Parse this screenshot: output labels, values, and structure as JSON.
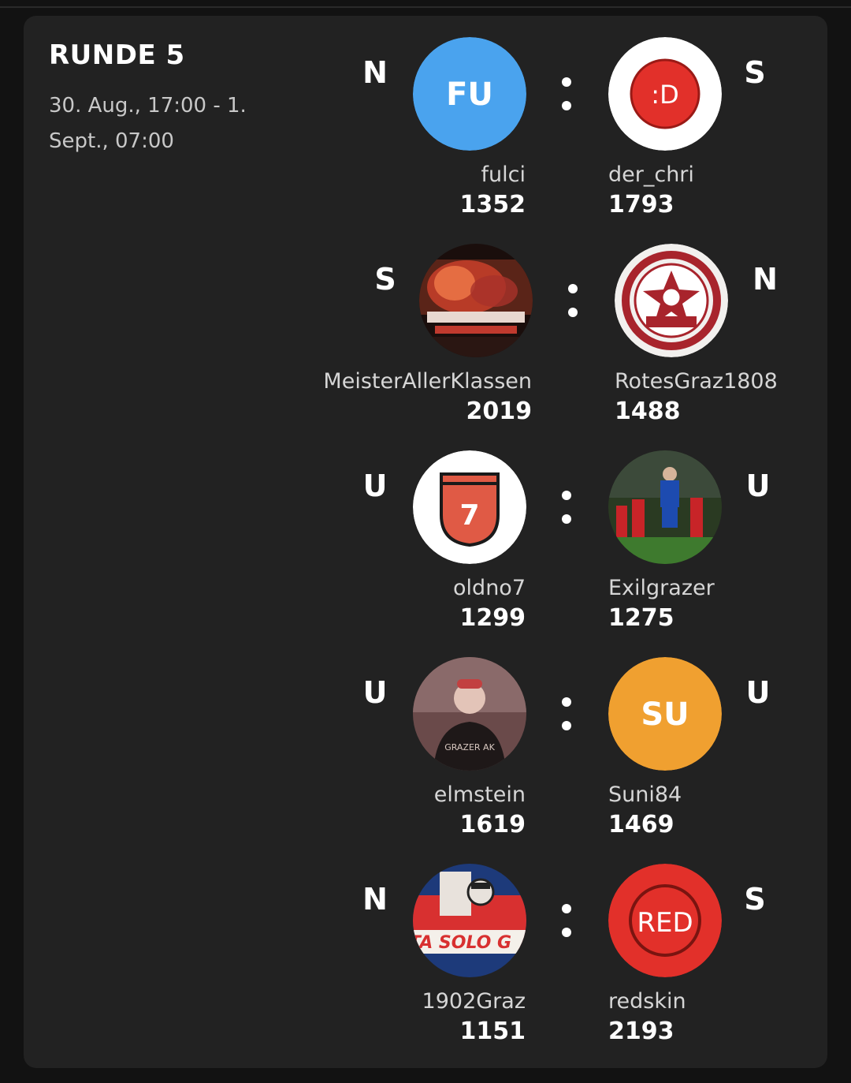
{
  "round": {
    "title": "RUNDE 5",
    "date": "30. Aug., 17:00 - 1. Sept., 07:00"
  },
  "colors": {
    "card_bg": "#222222",
    "page_bg": "#121212",
    "fu_avatar": "#4aa3ee",
    "su_avatar": "#f0a030",
    "red_avatar": "#e2302a"
  },
  "matches": [
    {
      "home": {
        "result": "N",
        "name": "fulci",
        "score": "1352",
        "avatar_text": "FU",
        "avatar_icon": "initials-avatar"
      },
      "away": {
        "result": "S",
        "name": "der_chri",
        "score": "1793",
        "avatar_text": ":D",
        "avatar_icon": "smiley-badge-avatar"
      }
    },
    {
      "home": {
        "result": "S",
        "name": "MeisterAllerKlassen",
        "score": "2019",
        "avatar_icon": "pyro-crowd-photo"
      },
      "away": {
        "result": "N",
        "name": "RotesGraz1808",
        "score": "1488",
        "avatar_icon": "club-crest-1902"
      }
    },
    {
      "home": {
        "result": "U",
        "name": "oldno7",
        "score": "1299",
        "avatar_text": "7",
        "avatar_icon": "shield-7-avatar"
      },
      "away": {
        "result": "U",
        "name": "Exilgrazer",
        "score": "1275",
        "avatar_icon": "football-header-photo"
      }
    },
    {
      "home": {
        "result": "U",
        "name": "elmstein",
        "score": "1619",
        "avatar_icon": "man-portrait-photo"
      },
      "away": {
        "result": "U",
        "name": "Suni84",
        "score": "1469",
        "avatar_text": "SU",
        "avatar_icon": "initials-avatar"
      }
    },
    {
      "home": {
        "result": "N",
        "name": "1902Graz",
        "score": "1151",
        "avatar_icon": "banner-illustration-photo"
      },
      "away": {
        "result": "S",
        "name": "redskin",
        "score": "2193",
        "avatar_text": "RED",
        "avatar_icon": "red-ring-avatar"
      }
    }
  ]
}
